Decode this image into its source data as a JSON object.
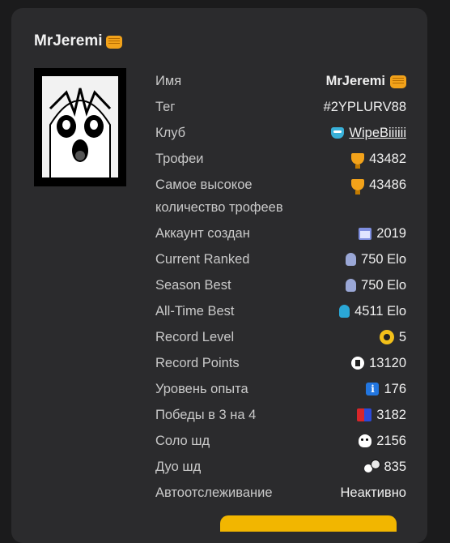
{
  "profile": {
    "title": "MrJeremi",
    "title_icon": "fist-icon"
  },
  "stats": [
    {
      "label": "Имя",
      "value": "MrJeremi",
      "icon": "fist-icon"
    },
    {
      "label": "Тег",
      "value": "#2YPLURV88",
      "icon": ""
    },
    {
      "label": "Клуб",
      "value": "WipeBiiiiii",
      "icon": "club-icon"
    },
    {
      "label": "Трофеи",
      "value": "43482",
      "icon": "trophy-icon"
    },
    {
      "label_line1": "Самое высокое",
      "label_line2": "количество трофеев",
      "value": "43486",
      "icon": "trophy-icon"
    },
    {
      "label": "Аккаунт создан",
      "value": "2019",
      "icon": "calendar-icon"
    },
    {
      "label": "Current Ranked",
      "value": "750 Elo",
      "icon": "rank-icon"
    },
    {
      "label": "Season Best",
      "value": "750 Elo",
      "icon": "rank-icon"
    },
    {
      "label": "All-Time Best",
      "value": "4511 Elo",
      "icon": "rank-icon"
    },
    {
      "label": "Record Level",
      "value": "5",
      "icon": "record-level-icon"
    },
    {
      "label": "Record Points",
      "value": "13120",
      "icon": "record-points-icon"
    },
    {
      "label": "Уровень опыта",
      "value": "176",
      "icon": "info-icon"
    },
    {
      "label": "Победы в 3 на 4",
      "value": "3182",
      "icon": "3v3-icon"
    },
    {
      "label": "Соло шд",
      "value": "2156",
      "icon": "skull-icon"
    },
    {
      "label": "Дуо шд",
      "value": "835",
      "icon": "duo-skull-icon"
    },
    {
      "label": "Автоотслеживание",
      "value": "Неактивно",
      "icon": ""
    }
  ],
  "colors": {
    "background": "#1b1b1c",
    "card": "#2b2b2d",
    "accent": "#f2a21a"
  }
}
